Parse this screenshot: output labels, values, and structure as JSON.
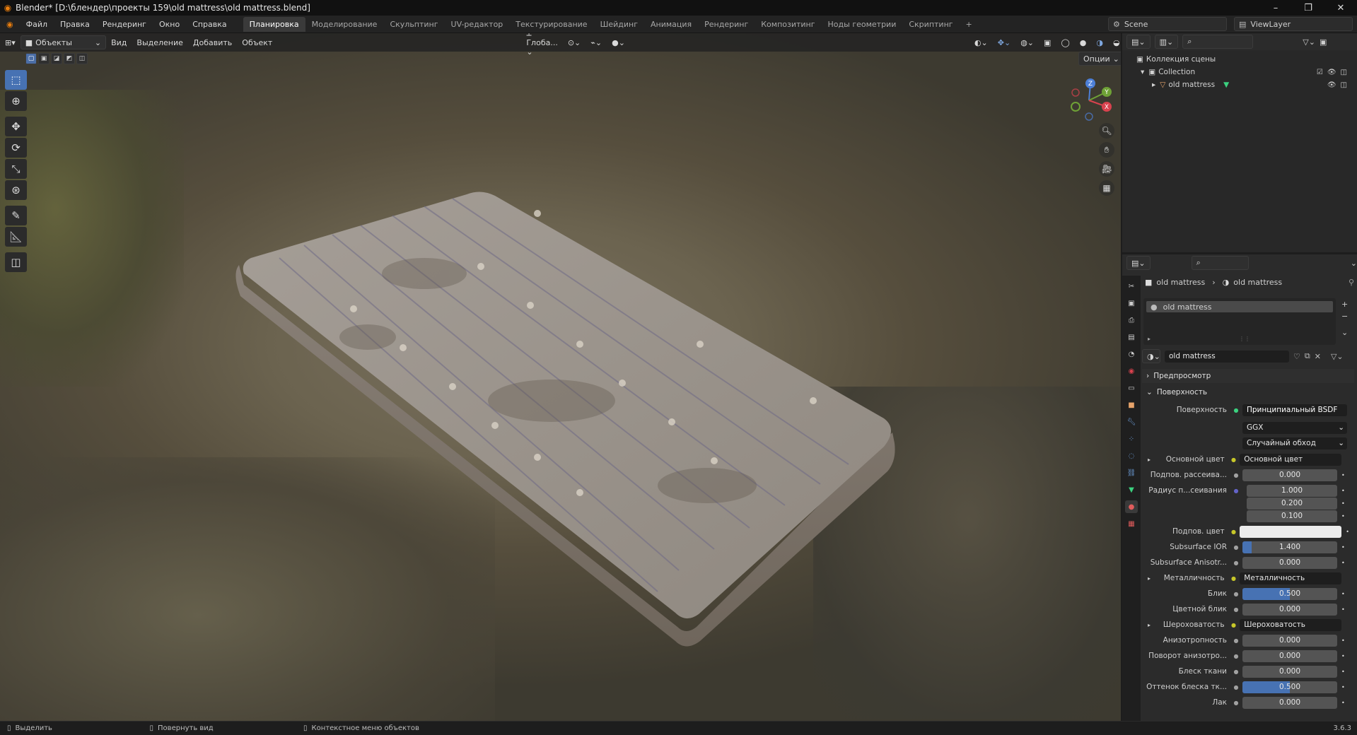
{
  "window": {
    "title": "Blender* [D:\\блендер\\проекты 159\\old mattress\\old mattress.blend]",
    "controls": [
      "–",
      "❐",
      "✕"
    ]
  },
  "menu": [
    "Файл",
    "Правка",
    "Рендеринг",
    "Окно",
    "Справка"
  ],
  "workspaces": [
    "Планировка",
    "Моделирование",
    "Скульптинг",
    "UV-редактор",
    "Текстурирование",
    "Шейдинг",
    "Анимация",
    "Рендеринг",
    "Композитинг",
    "Ноды геометрии",
    "Скриптинг"
  ],
  "active_workspace": "Планировка",
  "scene": {
    "label": "Scene",
    "view_layer": "ViewLayer"
  },
  "viewport": {
    "mode": "Объекты",
    "menus": [
      "Вид",
      "Выделение",
      "Добавить",
      "Объект"
    ],
    "transform_orientation": "Глоба...",
    "options_label": "Опции",
    "gizmo_axes": [
      "Z",
      "Y",
      "X"
    ],
    "object_name": "old mattress"
  },
  "outliner": {
    "root": "Коллекция сцены",
    "collection": "Collection",
    "object": "old mattress"
  },
  "properties": {
    "breadcrumb": [
      "old mattress",
      "old mattress"
    ],
    "material_slot": "old mattress",
    "material_name": "old mattress",
    "sections": {
      "preview": "Предпросмотр",
      "surface": "Поверхность"
    },
    "surface": {
      "label": "Поверхность",
      "value": "Принципиальный BSDF"
    },
    "distribution": "GGX",
    "subsurface_method": "Случайный обход",
    "rows": [
      {
        "label": "Основной цвет",
        "value": "Основной цвет",
        "kind": "link"
      },
      {
        "label": "Подпов. рассеива...",
        "value": "0.000",
        "fill": 0
      },
      {
        "label": "Радиус п...сеивания",
        "value": "1.000",
        "fill": 0
      },
      {
        "label": "",
        "value": "0.200",
        "fill": 0
      },
      {
        "label": "",
        "value": "0.100",
        "fill": 0
      },
      {
        "label": "Подпов. цвет",
        "value": "",
        "kind": "color"
      },
      {
        "label": "Subsurface IOR",
        "value": "1.400",
        "fill": 0.1
      },
      {
        "label": "Subsurface Anisotr...",
        "value": "0.000",
        "fill": 0
      },
      {
        "label": "Металличность",
        "value": "Металличность",
        "kind": "link"
      },
      {
        "label": "Блик",
        "value": "0.500",
        "fill": 0.5
      },
      {
        "label": "Цветной блик",
        "value": "0.000",
        "fill": 0
      },
      {
        "label": "Шероховатость",
        "value": "Шероховатость",
        "kind": "link"
      },
      {
        "label": "Анизотропность",
        "value": "0.000",
        "fill": 0
      },
      {
        "label": "Поворот анизотро...",
        "value": "0.000",
        "fill": 0
      },
      {
        "label": "Блеск ткани",
        "value": "0.000",
        "fill": 0
      },
      {
        "label": "Оттенок блеска тк...",
        "value": "0.500",
        "fill": 0.5
      },
      {
        "label": "Лак",
        "value": "0.000",
        "fill": 0
      }
    ]
  },
  "statusbar": {
    "left": "Выделить",
    "middle": "Повернуть вид",
    "right": "Контекстное меню объектов",
    "version": "3.6.3"
  },
  "colors": {
    "accent": "#4772b3",
    "bg": "#1d1d1d",
    "panel": "#2b2b2b"
  }
}
